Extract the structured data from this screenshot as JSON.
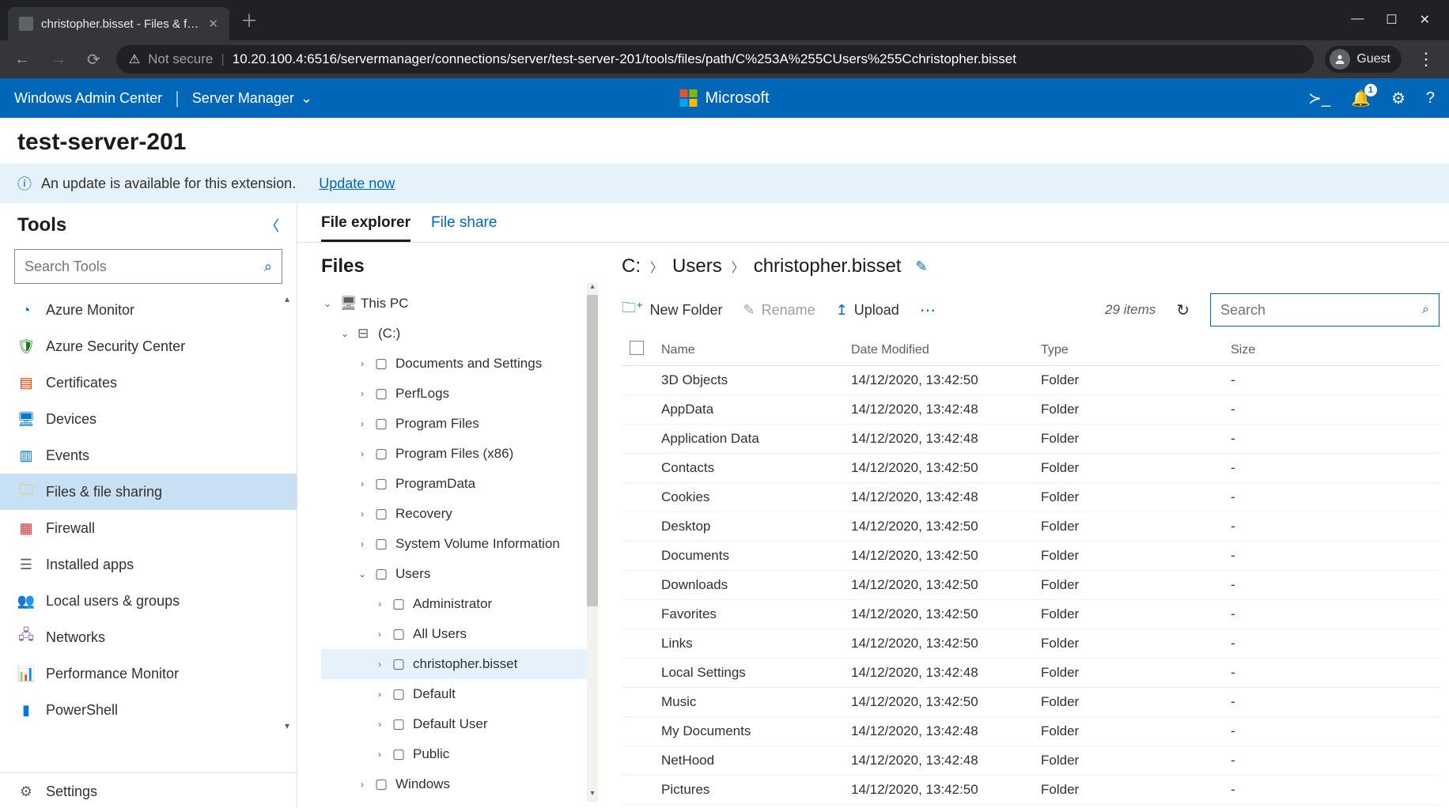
{
  "browser": {
    "tab_title": "christopher.bisset - Files & file sh",
    "not_secure": "Not secure",
    "url": "10.20.100.4:6516/servermanager/connections/server/test-server-201/tools/files/path/C%253A%255CUsers%255Cchristopher.bisset",
    "guest": "Guest"
  },
  "wac": {
    "brand": "Windows Admin Center",
    "scope": "Server Manager",
    "ms": "Microsoft",
    "notif_badge": "1"
  },
  "page": {
    "title": "test-server-201",
    "notif_text": "An update is available for this extension.",
    "notif_link": "Update now"
  },
  "tools": {
    "heading": "Tools",
    "search_placeholder": "Search Tools",
    "items": [
      {
        "label": "Azure Monitor",
        "icon": "◔",
        "color": "#0078d4"
      },
      {
        "label": "Azure Security Center",
        "icon": "🛡",
        "color": "#107c10"
      },
      {
        "label": "Certificates",
        "icon": "▤",
        "color": "#d83b01"
      },
      {
        "label": "Devices",
        "icon": "🖥",
        "color": "#0078d4"
      },
      {
        "label": "Events",
        "icon": "▥",
        "color": "#0078d4"
      },
      {
        "label": "Files & file sharing",
        "icon": "🗀",
        "color": "#ffb900"
      },
      {
        "label": "Firewall",
        "icon": "▦",
        "color": "#d13438"
      },
      {
        "label": "Installed apps",
        "icon": "☰",
        "color": "#605e5c"
      },
      {
        "label": "Local users & groups",
        "icon": "👥",
        "color": "#0078d4"
      },
      {
        "label": "Networks",
        "icon": "🖧",
        "color": "#8764b8"
      },
      {
        "label": "Performance Monitor",
        "icon": "📊",
        "color": "#0078d4"
      },
      {
        "label": "PowerShell",
        "icon": "▮",
        "color": "#0078d4"
      }
    ],
    "settings": "Settings"
  },
  "tabs": {
    "explorer": "File explorer",
    "share": "File share"
  },
  "tree": {
    "heading": "Files",
    "root": "This PC",
    "drive": "(C:)",
    "folders": [
      "Documents and Settings",
      "PerfLogs",
      "Program Files",
      "Program Files (x86)",
      "ProgramData",
      "Recovery",
      "System Volume Information",
      "Users"
    ],
    "users": [
      "Administrator",
      "All Users",
      "christopher.bisset",
      "Default",
      "Default User",
      "Public"
    ],
    "windows": "Windows"
  },
  "breadcrumb": [
    "C:",
    "Users",
    "christopher.bisset"
  ],
  "toolbar": {
    "new_folder": "New Folder",
    "rename": "Rename",
    "upload": "Upload",
    "count": "29 items",
    "search_placeholder": "Search"
  },
  "columns": {
    "name": "Name",
    "date": "Date Modified",
    "type": "Type",
    "size": "Size"
  },
  "rows": [
    {
      "name": "3D Objects",
      "date": "14/12/2020, 13:42:50",
      "type": "Folder",
      "size": "-"
    },
    {
      "name": "AppData",
      "date": "14/12/2020, 13:42:48",
      "type": "Folder",
      "size": "-"
    },
    {
      "name": "Application Data",
      "date": "14/12/2020, 13:42:48",
      "type": "Folder",
      "size": "-"
    },
    {
      "name": "Contacts",
      "date": "14/12/2020, 13:42:50",
      "type": "Folder",
      "size": "-"
    },
    {
      "name": "Cookies",
      "date": "14/12/2020, 13:42:48",
      "type": "Folder",
      "size": "-"
    },
    {
      "name": "Desktop",
      "date": "14/12/2020, 13:42:50",
      "type": "Folder",
      "size": "-"
    },
    {
      "name": "Documents",
      "date": "14/12/2020, 13:42:50",
      "type": "Folder",
      "size": "-"
    },
    {
      "name": "Downloads",
      "date": "14/12/2020, 13:42:50",
      "type": "Folder",
      "size": "-"
    },
    {
      "name": "Favorites",
      "date": "14/12/2020, 13:42:50",
      "type": "Folder",
      "size": "-"
    },
    {
      "name": "Links",
      "date": "14/12/2020, 13:42:50",
      "type": "Folder",
      "size": "-"
    },
    {
      "name": "Local Settings",
      "date": "14/12/2020, 13:42:48",
      "type": "Folder",
      "size": "-"
    },
    {
      "name": "Music",
      "date": "14/12/2020, 13:42:50",
      "type": "Folder",
      "size": "-"
    },
    {
      "name": "My Documents",
      "date": "14/12/2020, 13:42:48",
      "type": "Folder",
      "size": "-"
    },
    {
      "name": "NetHood",
      "date": "14/12/2020, 13:42:48",
      "type": "Folder",
      "size": "-"
    },
    {
      "name": "Pictures",
      "date": "14/12/2020, 13:42:50",
      "type": "Folder",
      "size": "-"
    }
  ]
}
